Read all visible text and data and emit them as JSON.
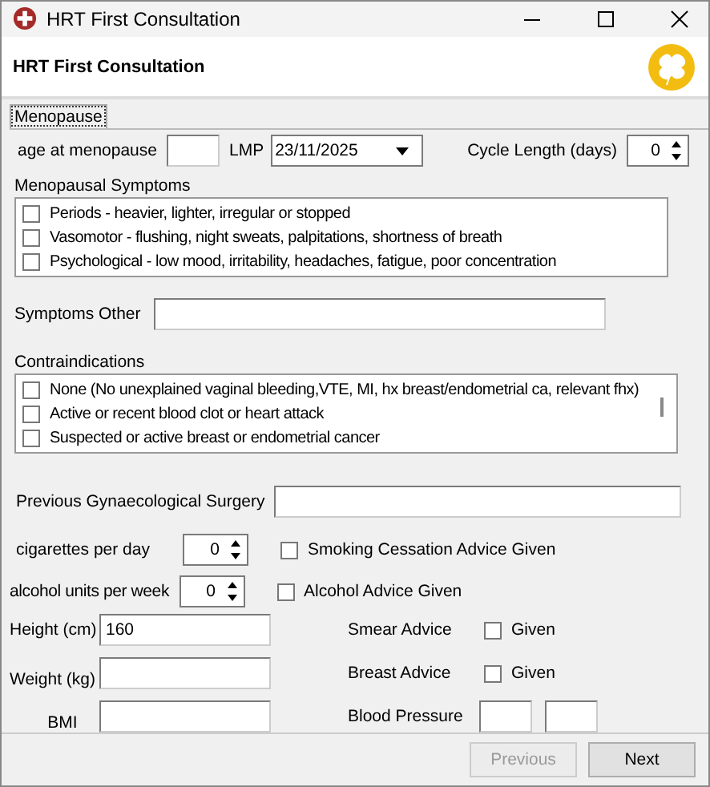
{
  "window": {
    "title": "HRT First Consultation"
  },
  "header": {
    "title": "HRT First Consultation"
  },
  "tabs": [
    {
      "label": "Menopause",
      "selected": true
    }
  ],
  "age_at_menopause": {
    "label": "age at menopause"
  },
  "lmp": {
    "label": "LMP",
    "value": "23/11/2025"
  },
  "cycle_length": {
    "label": "Cycle Length (days)",
    "value": "0"
  },
  "menopausal_symptoms": {
    "label": "Menopausal Symptoms",
    "items": [
      {
        "label": "Periods - heavier, lighter, irregular or stopped",
        "checked": false
      },
      {
        "label": "Vasomotor - flushing, night sweats, palpitations, shortness of breath",
        "checked": false
      },
      {
        "label": "Psychological - low mood, irritability, headaches, fatigue, poor concentration",
        "checked": false
      }
    ]
  },
  "symptoms_other": {
    "label": "Symptoms Other"
  },
  "contraindications": {
    "label": "Contraindications",
    "items": [
      {
        "label": "None (No unexplained vaginal bleeding,VTE, MI, hx breast/endometrial ca, relevant fhx)",
        "checked": false
      },
      {
        "label": "Active or recent blood clot or heart attack",
        "checked": false
      },
      {
        "label": "Suspected or active breast or endometrial cancer",
        "checked": false
      }
    ]
  },
  "previous_surgery": {
    "label": "Previous Gynaecological Surgery"
  },
  "cigarettes": {
    "label": "cigarettes per day",
    "value": "0",
    "advice": {
      "label": "Smoking Cessation Advice Given",
      "checked": false
    }
  },
  "alcohol": {
    "label": "alcohol units per week",
    "value": "0",
    "advice": {
      "label": "Alcohol Advice Given",
      "checked": false
    }
  },
  "height": {
    "label": "Height (cm)",
    "value": "160"
  },
  "smear_advice": {
    "label": "Smear Advice",
    "given": {
      "label": "Given",
      "checked": false
    }
  },
  "weight": {
    "label": "Weight (kg)"
  },
  "breast_advice": {
    "label": "Breast Advice",
    "given": {
      "label": "Given",
      "checked": false
    }
  },
  "bmi": {
    "label": "BMI"
  },
  "blood_pressure": {
    "label": "Blood Pressure"
  },
  "buttons": [
    {
      "label": "Previous",
      "disabled": true
    },
    {
      "label": "Next",
      "disabled": false
    }
  ]
}
